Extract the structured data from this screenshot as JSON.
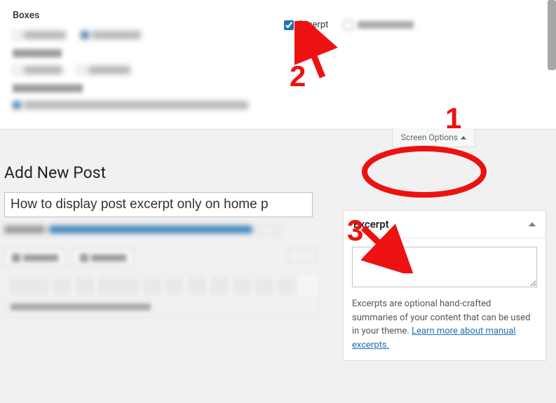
{
  "screen_options": {
    "panel_title": "Boxes",
    "excerpt_label": "Excerpt",
    "excerpt_checked": true,
    "toggle_label": "Screen Options"
  },
  "page": {
    "title": "Add New Post",
    "post_title_value": "How to display post excerpt only on home p"
  },
  "excerpt_meta": {
    "heading": "Excerpt",
    "textarea_value": "",
    "description_before": "Excerpts are optional hand-crafted summaries of your content that can be used in your theme. ",
    "link_text": "Learn more about manual excerpts."
  },
  "annotations": {
    "one": "1",
    "two": "2",
    "three": "3"
  }
}
